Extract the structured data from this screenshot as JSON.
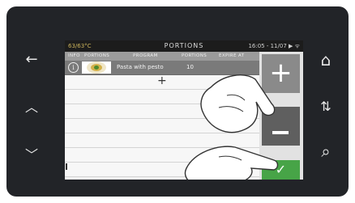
{
  "statusbar": {
    "temperature": "63/63°C",
    "title": "PORTIONS",
    "time_info": "16:05 - 11/07 ▶ ᯤ"
  },
  "table": {
    "headers": [
      "INFO",
      "PORTIONS",
      "PROGRAM",
      "PORTIONS",
      "EXPIRE AT"
    ],
    "rows": [
      {
        "name": "Pasta with pesto",
        "portions": "10"
      }
    ],
    "add_symbol": "+"
  },
  "buttons": {
    "increase": "+",
    "decrease": "−",
    "confirm": "✓"
  },
  "side_icons": {
    "back": "←",
    "up": "︿",
    "down": "﹀",
    "home": "⌂",
    "sort": "⇅",
    "search": "⌕"
  },
  "colors": {
    "accent_green": "#47a447",
    "selected_row": "#7a7a7a"
  }
}
